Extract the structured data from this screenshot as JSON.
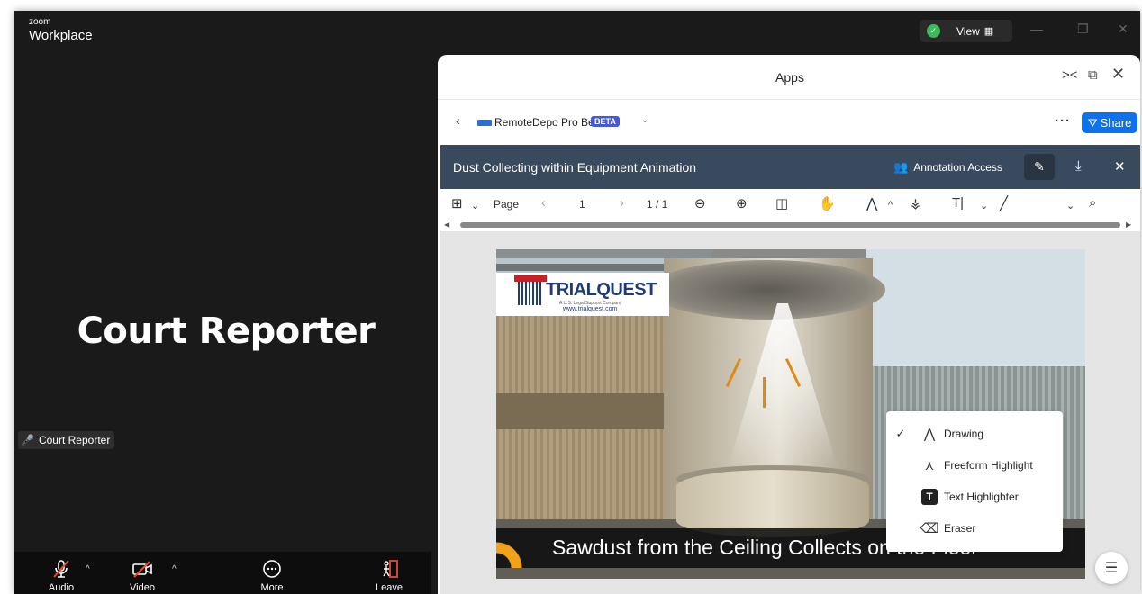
{
  "zoom": {
    "logo_top": "zoom",
    "logo_bottom": "Workplace",
    "view_label": "View",
    "speaker_name": "Court Reporter",
    "name_tag": "Court Reporter",
    "controls": {
      "audio": "Audio",
      "video": "Video",
      "more": "More",
      "leave": "Leave"
    }
  },
  "apps_panel": {
    "title": "Apps",
    "app_name": "RemoteDepo Pro Beta",
    "beta_badge": "BETA",
    "more_label": "···",
    "share_label": "Share",
    "document_title": "Dust Collecting within Equipment Animation",
    "annotation_access": "Annotation Access",
    "toolbar": {
      "page_label": "Page",
      "page_number": "1",
      "page_count": "1 / 1"
    }
  },
  "slide": {
    "brand": "TRIALQUEST",
    "tagline": "A U.S. Legal Support Company",
    "url": "www.trialquest.com",
    "caption": "Sawdust from the Ceiling Collects on the Floor"
  },
  "annotation_menu": {
    "items": [
      {
        "label": "Drawing",
        "checked": true,
        "icon": "pen-nib-icon"
      },
      {
        "label": "Freeform Highlight",
        "checked": false,
        "icon": "highlighter-nib-icon"
      },
      {
        "label": "Text Highlighter",
        "checked": false,
        "icon": "text-highlight-icon"
      },
      {
        "label": "Eraser",
        "checked": false,
        "icon": "eraser-icon"
      }
    ]
  },
  "colors": {
    "share_blue": "#0e72ed",
    "doc_bar": "#3a4a5e",
    "beta_purple": "#4759d8",
    "leave_red": "#e54b3d",
    "shield_green": "#3dbb5a"
  }
}
